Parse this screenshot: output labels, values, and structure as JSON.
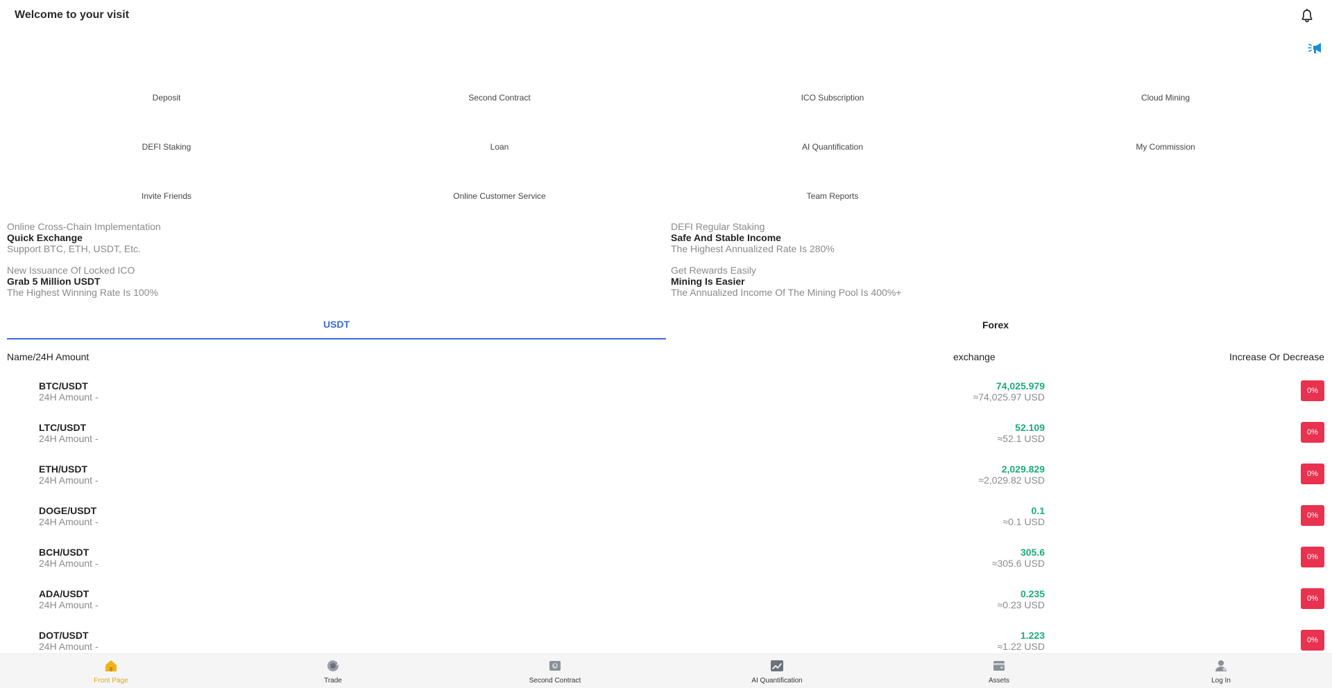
{
  "header": {
    "title": "Welcome to your visit"
  },
  "shortcuts": [
    {
      "label": "Deposit"
    },
    {
      "label": "Second Contract"
    },
    {
      "label": "ICO Subscription"
    },
    {
      "label": "Cloud Mining"
    },
    {
      "label": "DEFI Staking"
    },
    {
      "label": "Loan"
    },
    {
      "label": "AI Quantification"
    },
    {
      "label": "My Commission"
    },
    {
      "label": "Invite Friends"
    },
    {
      "label": "Online Customer Service"
    },
    {
      "label": "Team Reports"
    }
  ],
  "promos": [
    {
      "sub": "Online Cross-Chain Implementation",
      "main": "Quick Exchange",
      "desc": "Support BTC, ETH, USDT, Etc."
    },
    {
      "sub": "DEFI Regular Staking",
      "main": "Safe And Stable Income",
      "desc": "The Highest Annualized Rate Is 280%"
    },
    {
      "sub": "New Issuance Of Locked ICO",
      "main": "Grab 5 Million USDT",
      "desc": "The Highest Winning Rate Is 100%"
    },
    {
      "sub": "Get Rewards Easily",
      "main": "Mining Is Easier",
      "desc": "The Annualized Income Of The Mining Pool Is 400%+"
    }
  ],
  "tabs": {
    "usdt": "USDT",
    "forex": "Forex"
  },
  "table": {
    "col_name": "Name/24H Amount",
    "col_exchange": "exchange",
    "col_change": "Increase Or Decrease"
  },
  "rows": [
    {
      "pair": "BTC/USDT",
      "amount": "24H Amount -",
      "price": "74,025.979",
      "usd": "≈74,025.97 USD",
      "change": "0%"
    },
    {
      "pair": "LTC/USDT",
      "amount": "24H Amount -",
      "price": "52.109",
      "usd": "≈52.1 USD",
      "change": "0%"
    },
    {
      "pair": "ETH/USDT",
      "amount": "24H Amount -",
      "price": "2,029.829",
      "usd": "≈2,029.82 USD",
      "change": "0%"
    },
    {
      "pair": "DOGE/USDT",
      "amount": "24H Amount -",
      "price": "0.1",
      "usd": "≈0.1 USD",
      "change": "0%"
    },
    {
      "pair": "BCH/USDT",
      "amount": "24H Amount -",
      "price": "305.6",
      "usd": "≈305.6 USD",
      "change": "0%"
    },
    {
      "pair": "ADA/USDT",
      "amount": "24H Amount -",
      "price": "0.235",
      "usd": "≈0.23 USD",
      "change": "0%"
    },
    {
      "pair": "DOT/USDT",
      "amount": "24H Amount -",
      "price": "1.223",
      "usd": "≈1.22 USD",
      "change": "0%"
    }
  ],
  "nav": [
    {
      "label": "Front Page",
      "icon": "home-icon"
    },
    {
      "label": "Trade",
      "icon": "trade-icon"
    },
    {
      "label": "Second Contract",
      "icon": "contract-icon"
    },
    {
      "label": "AI Quantification",
      "icon": "chart-icon"
    },
    {
      "label": "Assets",
      "icon": "wallet-icon"
    },
    {
      "label": "Log In",
      "icon": "user-icon"
    }
  ],
  "colors": {
    "accent": "#3a6ad6",
    "price_up": "#1aab7a",
    "badge_red": "#e8324f",
    "nav_active": "#e3a812"
  }
}
